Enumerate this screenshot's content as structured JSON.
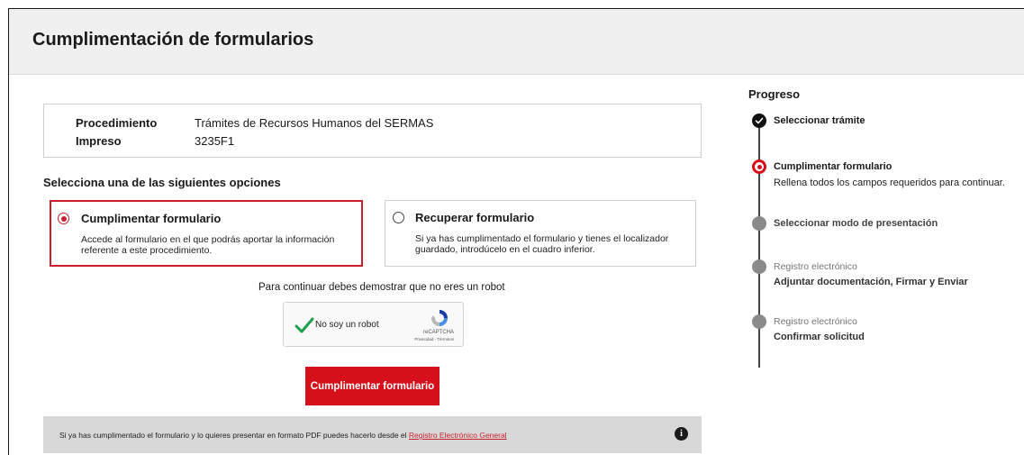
{
  "header": {
    "title": "Cumplimentación de formularios"
  },
  "info": {
    "procedimiento_label": "Procedimiento",
    "procedimiento_value": "Trámites de Recursos Humanos del SERMAS",
    "impreso_label": "Impreso",
    "impreso_value": "3235F1"
  },
  "options": {
    "title": "Selecciona una de las siguientes opciones",
    "cumplimentar": {
      "title": "Cumplimentar formulario",
      "desc": "Accede al formulario en el que podrás aportar la información referente a este procedimiento.",
      "selected": true
    },
    "recuperar": {
      "title": "Recuperar formulario",
      "desc": "Si ya has cumplimentado el formulario y tienes el localizador guardado, introdúcelo en el cuadro inferior.",
      "selected": false
    }
  },
  "captcha": {
    "prompt": "Para continuar debes demostrar que no eres un robot",
    "label": "No soy un robot",
    "brand": "reCAPTCHA",
    "privacy": "Privacidad - Términos"
  },
  "cta": {
    "label": "Cumplimentar formulario"
  },
  "pdf_bar": {
    "text": "Si ya has cumplimentado el formulario y lo quieres presentar en formato PDF puedes hacerlo desde el ",
    "link": "Registro Electrónico General",
    "info_glyph": "i"
  },
  "progress": {
    "title": "Progreso",
    "steps": [
      {
        "title": "Seleccionar trámite",
        "status": "done"
      },
      {
        "title": "Cumplimentar formulario",
        "desc": "Rellena todos los campos requeridos para continuar.",
        "status": "active"
      },
      {
        "title": "Seleccionar modo de presentación",
        "status": "pending"
      },
      {
        "pre": "Registro electrónico",
        "title": "Adjuntar documentación, Firmar y Enviar",
        "status": "pending"
      },
      {
        "pre": "Registro electrónico",
        "title": "Confirmar solicitud",
        "status": "pending"
      }
    ]
  },
  "colors": {
    "accent": "#d6101b",
    "selected_border": "#c8202f",
    "bar_bg": "#d8d8d8"
  }
}
